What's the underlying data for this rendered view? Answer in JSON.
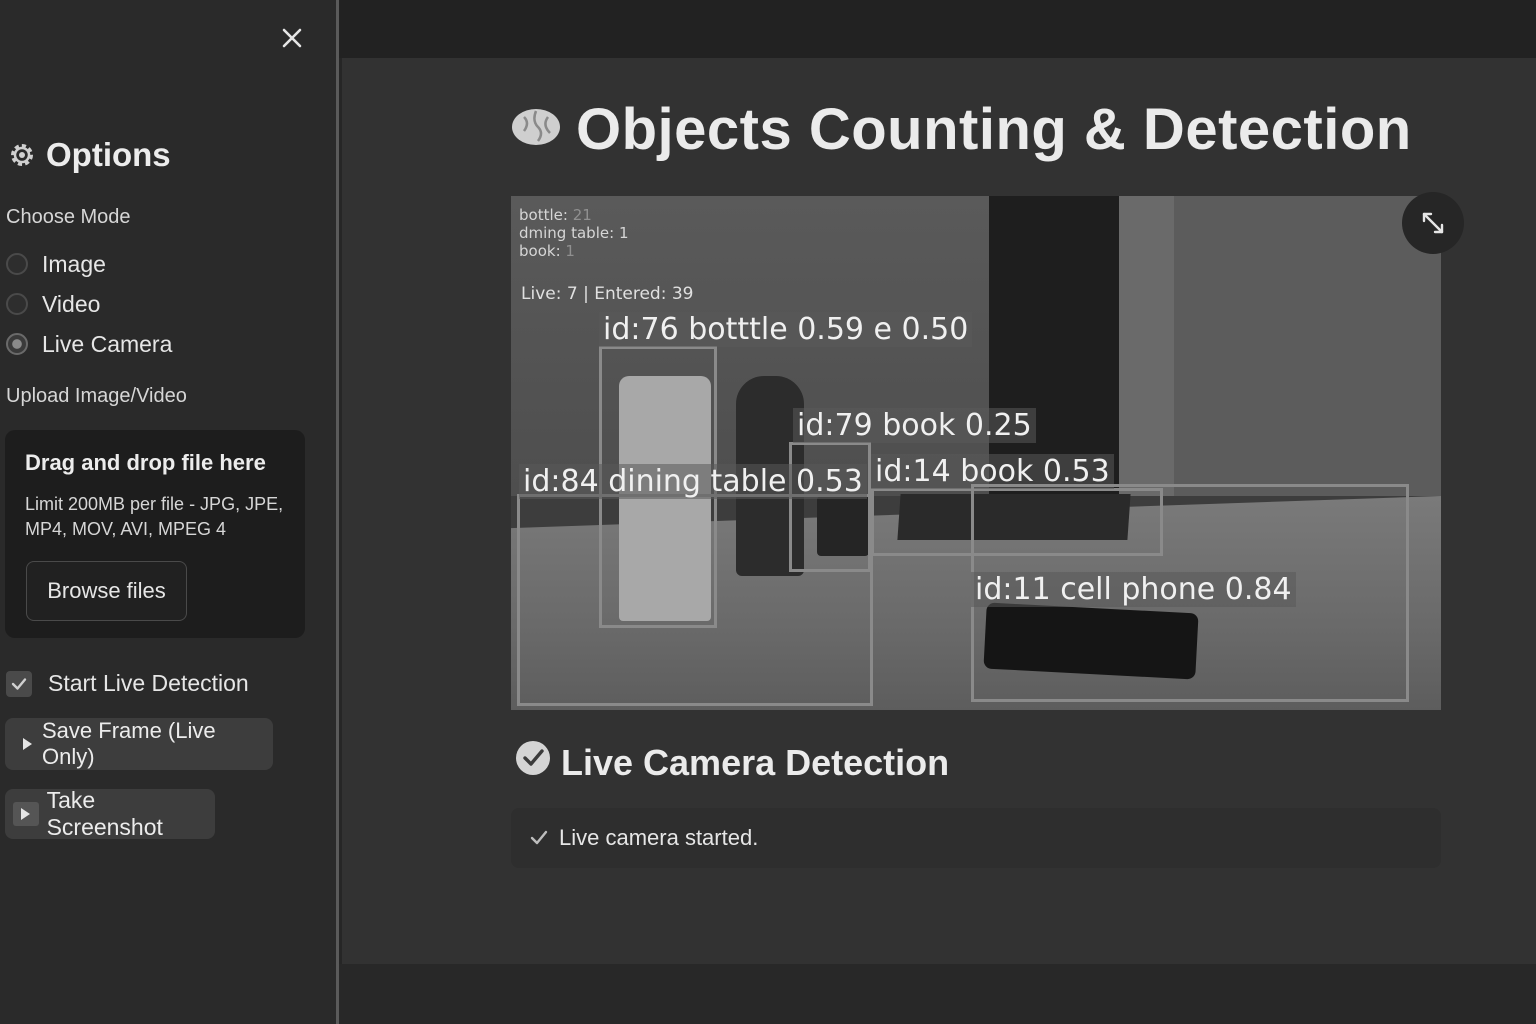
{
  "sidebar": {
    "title": "Options",
    "mode_label": "Choose Mode",
    "modes": [
      {
        "label": "Image",
        "checked": false
      },
      {
        "label": "Video",
        "checked": false
      },
      {
        "label": "Live Camera",
        "checked": true
      }
    ],
    "upload_label": "Upload Image/Video",
    "dropzone": {
      "title": "Drag and drop file here",
      "limit": "Limit 200MB per file - JPG, JPE, MP4, MOV, AVI, MPEG 4",
      "browse": "Browse files"
    },
    "start_live": {
      "label": "Start Live Detection",
      "checked": true
    },
    "save_frame": "Save Frame (Live Only)",
    "screenshot": "Take Screenshot"
  },
  "main": {
    "title": "Objects Counting & Detection",
    "hud": {
      "bottle_label": "bottle:",
      "bottle_count": "21",
      "table_label": "dming table:",
      "table_count": "1",
      "book_label": "book:",
      "book_count": "1",
      "live": "Live:  7  |  Entered:  39"
    },
    "detections": [
      {
        "id": "d1",
        "label": "id:76  botttle 0.59 e 0.50"
      },
      {
        "id": "d2",
        "label": "id:79  book 0.25"
      },
      {
        "id": "d3",
        "label": "id:84  dining table 0.53"
      },
      {
        "id": "d4",
        "label": "id:14  book  0.53"
      },
      {
        "id": "d5",
        "label": "id:11 cell phone 0.84"
      }
    ],
    "section_title": "Live Camera Detection",
    "status": "Live camera started."
  },
  "icons": {
    "close": "close-icon",
    "options": "gear-icon",
    "title": "brain-icon",
    "expand": "expand-icon",
    "section": "check-circle-icon",
    "status": "checkmark-icon"
  },
  "colors": {
    "sidebar_bg": "#2a2a2a",
    "main_bg": "#323232",
    "accent": "#8a8a8a"
  }
}
